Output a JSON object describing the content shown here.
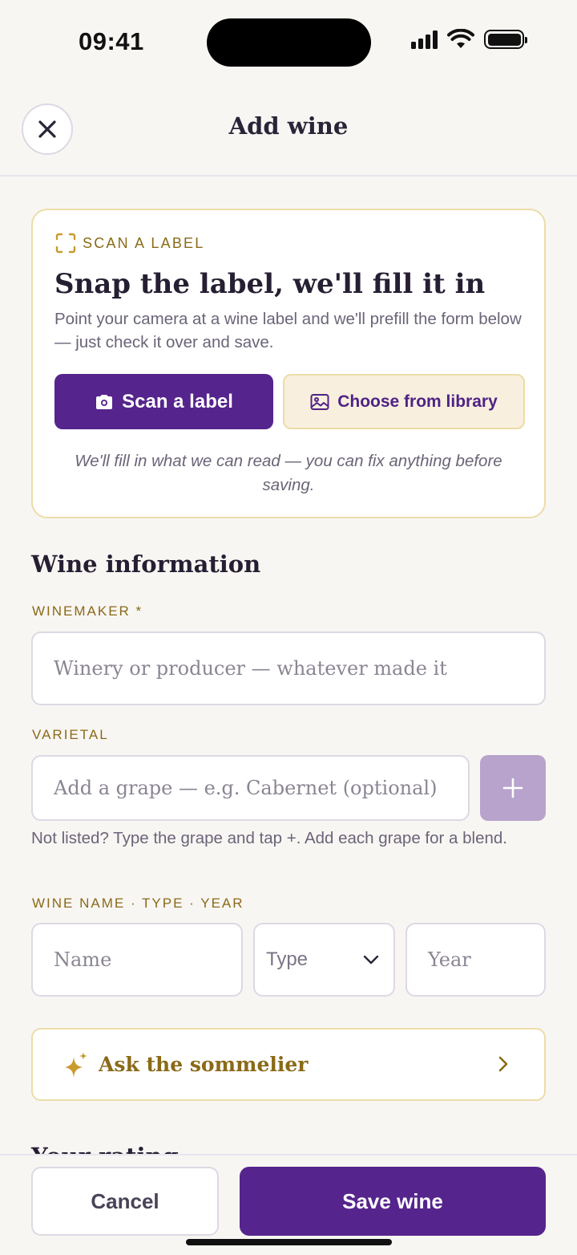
{
  "status_bar": {
    "time": "09:41"
  },
  "header": {
    "title": "Add wine"
  },
  "scan_card": {
    "eyebrow": "SCAN A LABEL",
    "heading": "Snap the label, we'll fill it in",
    "description": "Point your camera at a wine label and we'll prefill the form below — just check it over and save.",
    "scan_button": "Scan a label",
    "library_button": "Choose from library",
    "note": "We'll fill in what we can read — you can fix anything before saving."
  },
  "wine_info": {
    "title": "Wine information",
    "winemaker_label": "WINEMAKER *",
    "winemaker_placeholder": "Winery or producer — whatever made it",
    "varietal_label": "VARIETAL",
    "varietal_placeholder": "Add a grape — e.g. Cabernet (optional)",
    "varietal_add": "+",
    "varietal_hint": "Not listed? Type the grape and tap +. Add each grape for a blend.",
    "name_type_year_label": "WINE NAME · TYPE · YEAR",
    "name_placeholder": "Name",
    "type_selected": "Type",
    "year_placeholder": "Year"
  },
  "sommelier": {
    "label": "Ask the sommelier"
  },
  "next_section_peek": "Your rating",
  "footer": {
    "cancel": "Cancel",
    "save": "Save wine"
  },
  "colors": {
    "primary": "#55248c",
    "gold": "#8a6a18",
    "gold_border": "#ecdca8",
    "background": "#f8f6f3"
  },
  "icons": {
    "close": "close-icon",
    "scan_frame": "scan-frame-icon",
    "camera": "camera-icon",
    "image": "image-icon",
    "sparkle": "sparkle-icon",
    "chevron_right": "chevron-right-icon",
    "chevron_down": "chevron-down-icon",
    "plus": "plus-icon"
  }
}
